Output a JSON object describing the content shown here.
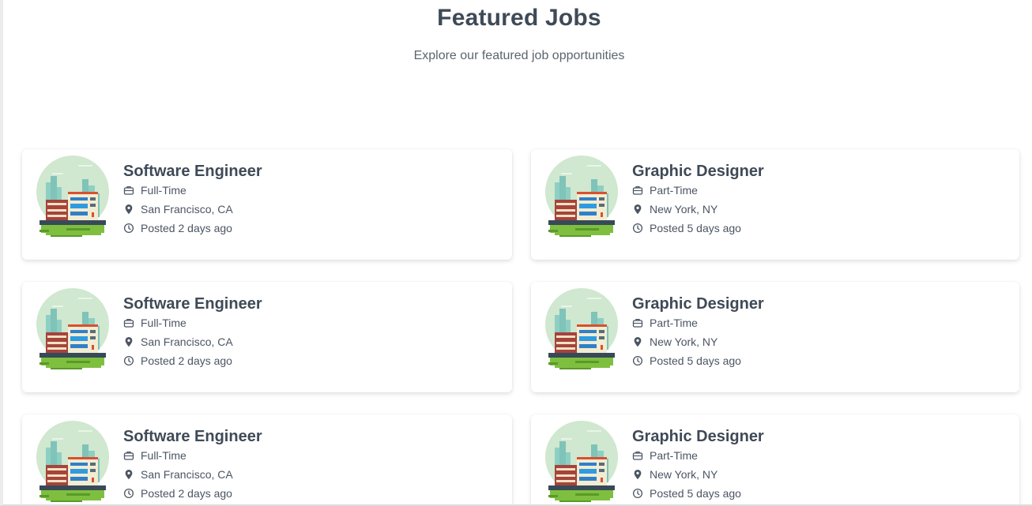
{
  "header": {
    "title": "Featured Jobs",
    "subtitle": "Explore our featured job opportunities"
  },
  "jobs": [
    {
      "title": "Software Engineer",
      "type": "Full-Time",
      "location": "San Francisco, CA",
      "posted": "Posted 2 days ago"
    },
    {
      "title": "Graphic Designer",
      "type": "Part-Time",
      "location": "New York, NY",
      "posted": "Posted 5 days ago"
    },
    {
      "title": "Software Engineer",
      "type": "Full-Time",
      "location": "San Francisco, CA",
      "posted": "Posted 2 days ago"
    },
    {
      "title": "Graphic Designer",
      "type": "Part-Time",
      "location": "New York, NY",
      "posted": "Posted 5 days ago"
    },
    {
      "title": "Software Engineer",
      "type": "Full-Time",
      "location": "San Francisco, CA",
      "posted": "Posted 2 days ago"
    },
    {
      "title": "Graphic Designer",
      "type": "Part-Time",
      "location": "New York, NY",
      "posted": "Posted 5 days ago"
    }
  ],
  "icons": {
    "job_type": "briefcase-icon",
    "location": "map-pin-icon",
    "posted": "clock-icon",
    "thumbnail": "city-building-illustration"
  },
  "colors": {
    "title": "#3f4a57",
    "text": "#4b5563",
    "illustration_sky": "#cfe8cf",
    "illustration_grass": "#7fbf3f"
  }
}
